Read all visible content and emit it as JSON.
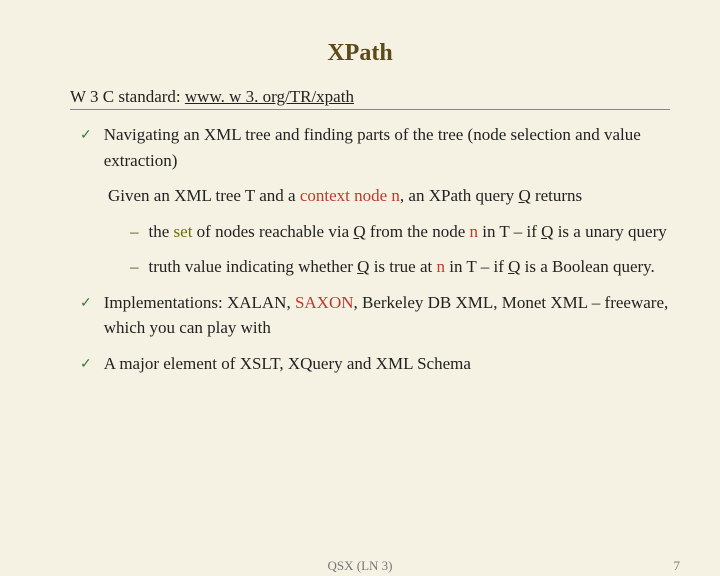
{
  "title": "XPath",
  "subtitle_prefix": "W 3 C standard: ",
  "subtitle_link": "www. w 3. org/TR/xpath",
  "bullet1": "Navigating an XML tree and finding parts of the tree (node selection and value extraction)",
  "para1_a": "Given an XML tree T and a ",
  "para1_b": "context node n",
  "para1_c": ", an XPath query ",
  "para1_d": "Q",
  "para1_e": " returns",
  "dash1_a": " the ",
  "dash1_b": "set",
  "dash1_c": " of nodes reachable via ",
  "dash1_d": "Q",
  "dash1_e": " from the node ",
  "dash1_f": "n",
  "dash1_g": " in T – if ",
  "dash1_h": "Q",
  "dash1_i": " is a unary query",
  "dash2_a": "truth value indicating whether ",
  "dash2_b": "Q",
  "dash2_c": " is true at ",
  "dash2_d": "n",
  "dash2_e": " in T – if ",
  "dash2_f": "Q",
  "dash2_g": " is a Boolean query.",
  "bullet2_a": "Implementations: XALAN, ",
  "bullet2_b": "SAXON",
  "bullet2_c": ", Berkeley DB XML, Monet XML – freeware, which you can play with",
  "bullet3": "A major element of XSLT, XQuery and XML Schema",
  "footer_center": "QSX (LN 3)",
  "footer_right": "7"
}
